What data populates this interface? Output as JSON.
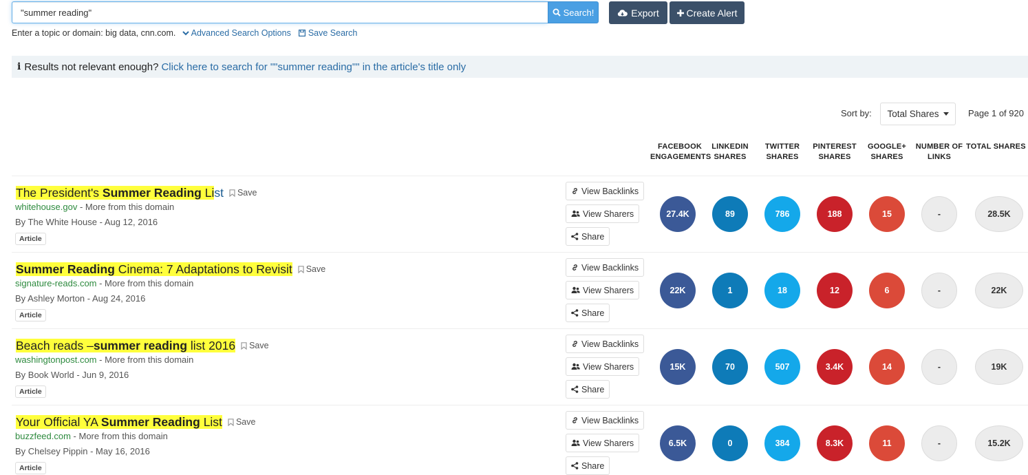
{
  "search": {
    "value": "\"summer reading\"",
    "button_label": "Search!"
  },
  "toolbar": {
    "export_label": "Export",
    "create_alert_label": "Create Alert"
  },
  "hints": {
    "topic_hint": "Enter a topic or domain: big data, cnn.com.",
    "advanced_label": "Advanced Search Options",
    "save_search_label": "Save Search"
  },
  "relevance": {
    "prefix": "Results not relevant enough?",
    "link": "Click here to search for \"\"summer reading\"\" in the article's title only"
  },
  "sort": {
    "label": "Sort by:",
    "selected": "Total Shares",
    "page_info": "Page 1 of 920"
  },
  "columns": [
    {
      "line1": "FACEBOOK",
      "line2": "ENGAGEMENTS"
    },
    {
      "line1": "LINKEDIN",
      "line2": "SHARES"
    },
    {
      "line1": "TWITTER",
      "line2": "SHARES"
    },
    {
      "line1": "PINTEREST",
      "line2": "SHARES"
    },
    {
      "line1": "GOOGLE+",
      "line2": "SHARES"
    },
    {
      "line1": "NUMBER OF",
      "line2": "LINKS"
    },
    {
      "line1": "TOTAL SHARES",
      "line2": ""
    }
  ],
  "actions": {
    "backlinks": "View Backlinks",
    "sharers": "View Sharers",
    "share": "Share",
    "save": "Save",
    "more_from_domain": " - More from this domain"
  },
  "results": [
    {
      "title_parts": [
        "The President's ",
        "Summer Reading",
        " Li",
        "st"
      ],
      "domain": "whitehouse.gov",
      "author": "By The White House - Aug 12, 2016",
      "tag": "Article",
      "metrics": [
        "27.4K",
        "89",
        "786",
        "188",
        "15",
        "-",
        "28.5K"
      ]
    },
    {
      "title_parts": [
        "",
        "Summer Reading",
        " Cinema: 7 Adaptations to Revisit",
        ""
      ],
      "domain": "signature-reads.com",
      "author": "By Ashley Morton - Aug 24, 2016",
      "tag": "Article",
      "metrics": [
        "22K",
        "1",
        "18",
        "12",
        "6",
        "-",
        "22K"
      ]
    },
    {
      "title_parts": [
        "Beach reads –",
        "summer reading",
        " list 2016",
        ""
      ],
      "domain": "washingtonpost.com",
      "author": "By Book World - Jun 9, 2016",
      "tag": "Article",
      "metrics": [
        "15K",
        "70",
        "507",
        "3.4K",
        "14",
        "-",
        "19K"
      ]
    },
    {
      "title_parts": [
        "Your Official YA ",
        "Summer Reading",
        " List",
        ""
      ],
      "domain": "buzzfeed.com",
      "author": "By Chelsey Pippin - May 16, 2016",
      "tag": "Article",
      "metrics": [
        "6.5K",
        "0",
        "384",
        "8.3K",
        "11",
        "-",
        "15.2K"
      ]
    }
  ]
}
